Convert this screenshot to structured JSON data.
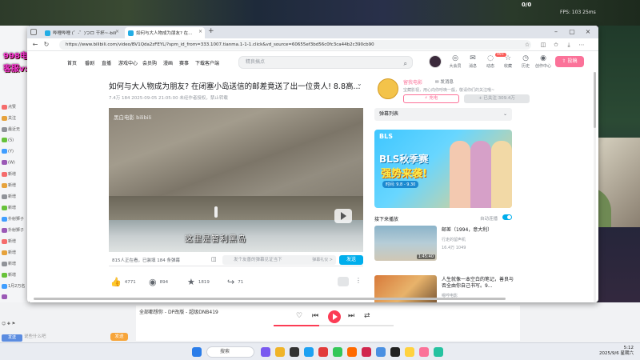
{
  "overlay": {
    "title": "998电竞千分猛男/甜妹",
    "contact": "客服v: ydpw666",
    "hud_score": "0/0",
    "hud_stats": "FPS: 103   25ms"
  },
  "stream_chat": {
    "lines": [
      "点赞",
      "关注",
      "最近无",
      "(S)",
      "(Y)",
      "(W)",
      "新增",
      "新增",
      "新增",
      "新增",
      "扑射狮子",
      "扑射狮子",
      "新增",
      "新增",
      "新增",
      "新增",
      "1月2万名",
      ""
    ],
    "input_placeholder": "说些什么吧",
    "send_label": "发送"
  },
  "player_bar": {
    "title": "全部都想你 - DP改版 - 超级DNB419",
    "progress_pct": 38
  },
  "browser": {
    "tabs": [
      {
        "label": "哔哩哔哩 (゜-゜)つロ 干杯~-bili",
        "active": false
      },
      {
        "label": "如何与大人物成为朋友? 在...",
        "active": true
      }
    ],
    "new_tab": "+",
    "url": "https://www.bilibili.com/video/BV1Qda2zFEYL/?spm_id_from=333.1007.tianma.1-1-1.click&vd_source=60655ef3bd56c0fc3ca44b2c390cb90"
  },
  "bili": {
    "nav": [
      "首页",
      "番剧",
      "直播",
      "游戏中心",
      "会员购",
      "漫画",
      "赛事",
      "下载客户端"
    ],
    "search_placeholder": "精良搞点",
    "header_icons": [
      {
        "name": "大会员",
        "glyph": "◎"
      },
      {
        "name": "消息",
        "glyph": "✉"
      },
      {
        "name": "动态",
        "glyph": "◌"
      },
      {
        "name": "收藏",
        "glyph": "☆"
      },
      {
        "name": "历史",
        "glyph": "◷"
      },
      {
        "name": "创作中心",
        "glyph": "◉"
      }
    ],
    "msg_count": "99+",
    "upload_label": "投稿"
  },
  "video": {
    "title": "如何与大人物成为朋友? 在闭塞小岛送信的邮差竟送了出一位贵人! 8.8高...",
    "meta": "7.4万   184   2025-09-05 21:05:00   未经作者授权，禁止转载",
    "watermark": "黑白电影 bilibili",
    "subtitle": "这里是智利黑岛",
    "viewers": "815人正在看，已装填 184 条弹幕",
    "dm_placeholder": "发个友善的弹幕见证当下",
    "dm_etiquette": "弹幕礼仪 >",
    "dm_send": "发送",
    "actions": [
      {
        "icon": "👍",
        "count": "4771"
      },
      {
        "icon": "◉",
        "count": "894"
      },
      {
        "icon": "★",
        "count": "1819"
      },
      {
        "icon": "↪",
        "count": "71"
      }
    ]
  },
  "up": {
    "name": "留我电影",
    "charge_tag": "发消息",
    "desc": "宝藏影视，用心向你呼唤一般，敬请你们的关注哦~",
    "charge_btn": "充电",
    "follow_btn": "+ 已关注 309.4万"
  },
  "dm_list": {
    "label": "弹幕列表"
  },
  "ad": {
    "logo": "BLS",
    "line1": "BLS秋季赛",
    "line2": "强势来袭!",
    "date": "时间: 9.8 - 9.30"
  },
  "next": {
    "label": "接下来播放",
    "autoplay": "自动连播"
  },
  "recs": [
    {
      "title": "邮差（1994，意大利）",
      "up": "行走的留声机",
      "stats": "16.4万   1049",
      "duration": "1:45:40"
    },
    {
      "title": "人生就像一本空白的笔记，善良与否全由你自己书写。9...",
      "up": "嗯哼电影",
      "stats": "",
      "duration": ""
    }
  ],
  "taskbar": {
    "search": "搜索",
    "time": "5:12",
    "date": "2025/9/6 星期六"
  }
}
